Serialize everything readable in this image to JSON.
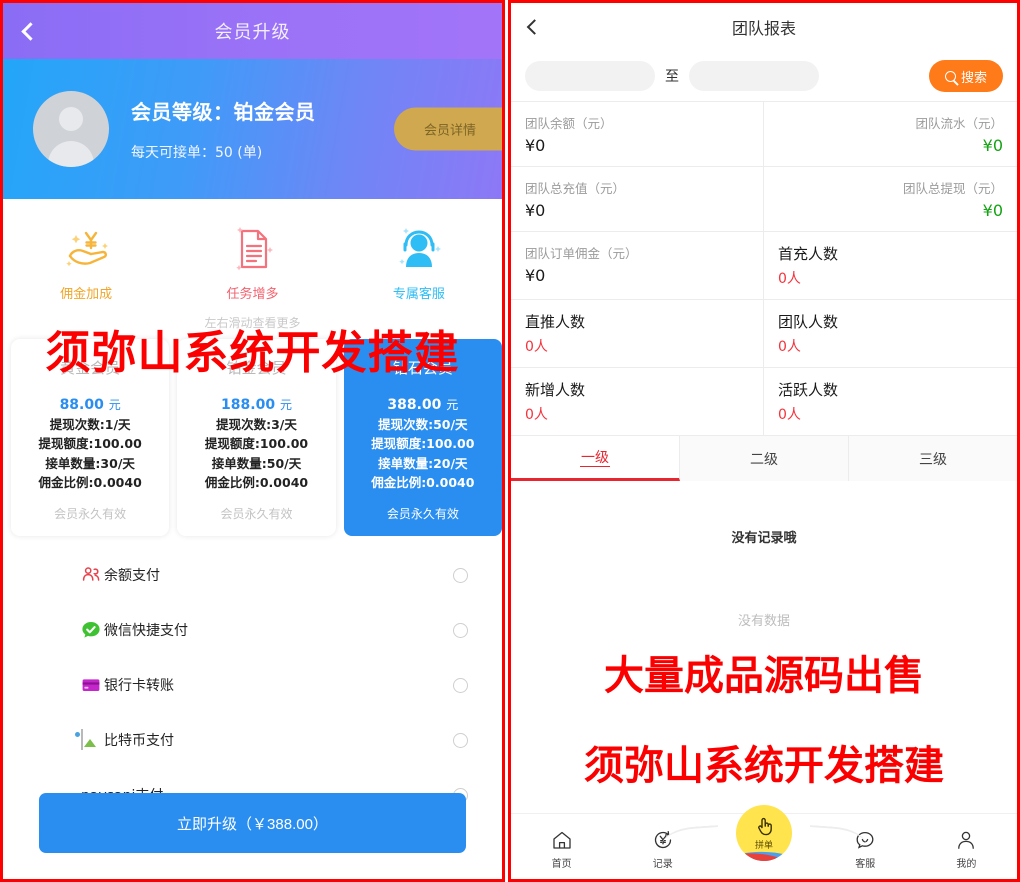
{
  "left": {
    "header": {
      "title": "会员升级",
      "back_icon": "chevron-left-icon"
    },
    "hero": {
      "level_label": "会员等级：铂金会员",
      "daily_orders": "每天可接单：50 (单)",
      "detail_button": "会员详情",
      "avatar_icon": "user-avatar-icon"
    },
    "features": [
      {
        "label": "佣金加成",
        "icon": "hand-yen-icon",
        "color": "#f0a52a"
      },
      {
        "label": "任务增多",
        "icon": "document-lines-icon",
        "color": "#f2636f"
      },
      {
        "label": "专属客服",
        "icon": "headset-person-icon",
        "color": "#2fbdf5"
      }
    ],
    "swipe_hint": "左右滑动查看更多",
    "cards": [
      {
        "name": "黄金会员",
        "price": "88.00",
        "price_unit": "元",
        "specs": [
          "提现次数:1/天",
          "提现额度:100.00",
          "接单数量:30/天",
          "佣金比例:0.0040"
        ],
        "validity": "会员永久有效",
        "selected": false
      },
      {
        "name": "铂金会员",
        "price": "188.00",
        "price_unit": "元",
        "specs": [
          "提现次数:3/天",
          "提现额度:100.00",
          "接单数量:50/天",
          "佣金比例:0.0040"
        ],
        "validity": "会员永久有效",
        "selected": false
      },
      {
        "name": "钻石会员",
        "price": "388.00",
        "price_unit": "元",
        "specs": [
          "提现次数:50/天",
          "提现额度:100.00",
          "接单数量:20/天",
          "佣金比例:0.0040"
        ],
        "validity": "会员永久有效",
        "selected": true
      }
    ],
    "payments": [
      {
        "label": "余额支付",
        "icon": "balance-people-icon",
        "selected": false
      },
      {
        "label": "微信快捷支付",
        "icon": "wechat-icon",
        "selected": false
      },
      {
        "label": "银行卡转账",
        "icon": "bank-card-icon",
        "selected": false
      },
      {
        "label": "比特币支付",
        "icon": "broken-image-icon",
        "selected": false
      },
      {
        "label": "paysapi支付",
        "icon": "broken-image-icon",
        "selected": false
      }
    ],
    "upgrade_button": "立即升级（￥388.00）",
    "watermark": "须弥山系统开发搭建"
  },
  "right": {
    "header": {
      "title": "团队报表",
      "back_icon": "chevron-left-icon"
    },
    "search": {
      "start_placeholder": "",
      "start_value": "",
      "separator": "至",
      "end_placeholder": "",
      "end_value": "",
      "button_label": "搜索",
      "button_icon": "search-icon",
      "button_color": "#ff7a18"
    },
    "stats": [
      [
        {
          "key": "团队余额（元）",
          "value": "¥0",
          "align": "left",
          "style": "dark"
        },
        {
          "key": "团队流水（元）",
          "value": "¥0",
          "align": "right",
          "style": "green"
        }
      ],
      [
        {
          "key": "团队总充值（元）",
          "value": "¥0",
          "align": "left",
          "style": "dark"
        },
        {
          "key": "团队总提现（元）",
          "value": "¥0",
          "align": "right",
          "style": "green"
        }
      ],
      [
        {
          "key": "团队订单佣金（元）",
          "value": "¥0",
          "align": "left",
          "style": "dark"
        },
        {
          "key": "首充人数",
          "value": "0人",
          "align": "left",
          "style": "red-big"
        }
      ],
      [
        {
          "key": "直推人数",
          "value": "0人",
          "align": "left",
          "style": "red-big"
        },
        {
          "key": "团队人数",
          "value": "0人",
          "align": "left",
          "style": "red-big"
        }
      ],
      [
        {
          "key": "新增人数",
          "value": "0人",
          "align": "left",
          "style": "red-big"
        },
        {
          "key": "活跃人数",
          "value": "0人",
          "align": "left",
          "style": "red-big"
        }
      ]
    ],
    "tabs": [
      {
        "label": "一级",
        "active": true
      },
      {
        "label": "二级",
        "active": false
      },
      {
        "label": "三级",
        "active": false
      }
    ],
    "empty_primary": "没有记录哦",
    "empty_secondary": "没有数据",
    "watermark_1": "大量成品源码出售",
    "watermark_2": "须弥山系统开发搭建",
    "tabbar": [
      {
        "label": "首页",
        "icon": "home-icon"
      },
      {
        "label": "记录",
        "icon": "yen-record-icon"
      },
      {
        "label": "拼单",
        "icon": "hand-tap-icon",
        "fab": true
      },
      {
        "label": "客服",
        "icon": "chat-smile-icon"
      },
      {
        "label": "我的",
        "icon": "person-icon"
      }
    ]
  }
}
